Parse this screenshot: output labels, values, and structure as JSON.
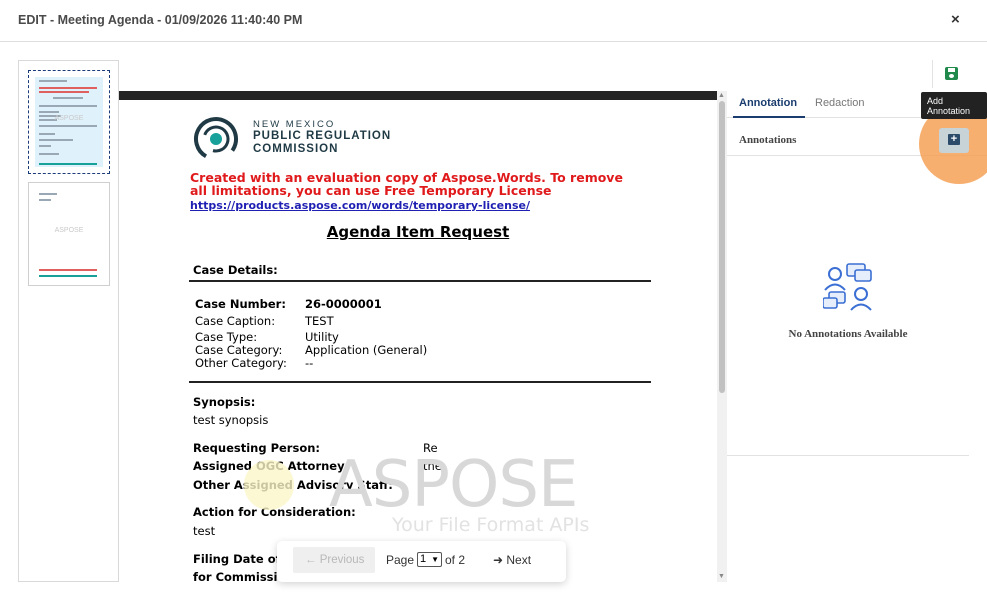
{
  "window": {
    "title": "EDIT - Meeting Agenda - 01/09/2026 11:40:40 PM",
    "close_glyph": "×"
  },
  "thumbnails": {
    "watermark": "ASPOSE"
  },
  "document": {
    "logo": {
      "line1": "NEW MEXICO",
      "line2": "PUBLIC REGULATION",
      "line3": "COMMISSION"
    },
    "eval_notice": "Created with an evaluation copy of Aspose.Words. To remove all limitations, you can use Free Temporary License",
    "eval_link": "https://products.aspose.com/words/temporary-license/",
    "title": "Agenda Item Request",
    "case_details_heading": "Case Details:",
    "case_number_label": "Case Number:",
    "case_number": "26-0000001",
    "case_caption_label": "Case Caption:",
    "case_caption": "TEST",
    "case_type_label": "Case Type:",
    "case_type": "Utility",
    "case_category_label": "Case Category:",
    "case_category": "Application (General)",
    "other_category_label": "Other Category:",
    "other_category": "--",
    "synopsis_label": "Synopsis:",
    "synopsis": "test synopsis",
    "requesting_person_label": "Requesting Person:",
    "requesting_person": "Re",
    "ogc_attorney_label": "Assigned OGC Attorney:",
    "ogc_attorney": "the",
    "advisory_staff_label": "Other Assigned Advisory Staff:",
    "advisory_staff": "--",
    "action_label": "Action for Consideration:",
    "action": "test",
    "filing_date_label": "Filing Date of",
    "commission_label": "for Commission Action",
    "watermark": "ASPOSE",
    "watermark_sub": "Your File Format APIs"
  },
  "pager": {
    "prev_label": "← Previous",
    "page_label": "Page",
    "current_page": "1",
    "of_label": "of 2",
    "next_label": "Next"
  },
  "right_panel": {
    "tab_annotation": "Annotation",
    "tab_redaction": "Redaction",
    "annotations_heading": "Annotations",
    "empty_text": "No Annotations Available",
    "add_tooltip": "Add Annotation"
  },
  "colors": {
    "accent": "#1a3c6e",
    "save_green": "#1f8a4c",
    "highlight": "#f59e50",
    "eval_red": "#e0191b"
  }
}
